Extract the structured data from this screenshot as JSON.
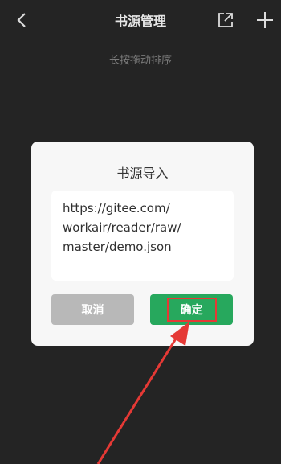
{
  "header": {
    "title": "书源管理",
    "back_icon": "back-arrow-icon",
    "export_icon": "export-icon",
    "add_icon": "plus-icon"
  },
  "hint": "长按拖动排序",
  "dialog": {
    "title": "书源导入",
    "url": "https://gitee.com/\nworkair/reader/raw/\nmaster/demo.json",
    "cancel_label": "取消",
    "ok_label": "确定"
  },
  "colors": {
    "background": "#242424",
    "dialog_bg": "#f7f7f7",
    "cancel_button": "#b8b8b8",
    "ok_button": "#27a85d",
    "annotation": "#e53935"
  }
}
